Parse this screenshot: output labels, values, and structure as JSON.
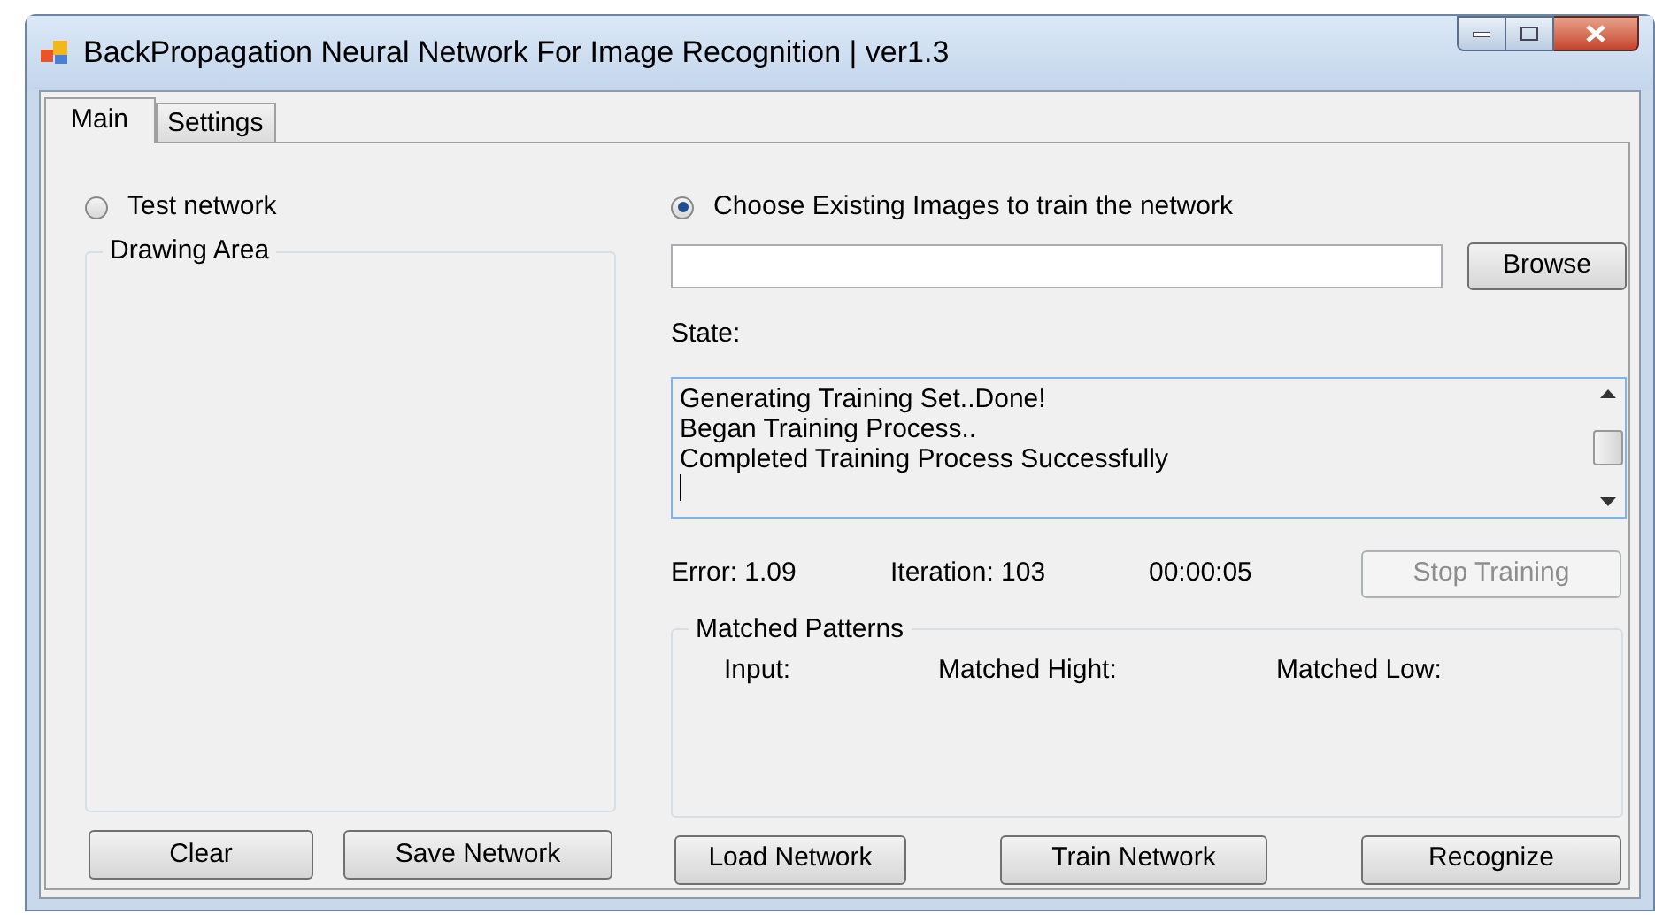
{
  "window": {
    "title": "BackPropagation Neural Network For Image Recognition | ver1.3"
  },
  "tabs": [
    {
      "label": "Main",
      "selected": true
    },
    {
      "label": "Settings",
      "selected": false
    }
  ],
  "left": {
    "mode": {
      "label": "Test network",
      "selected": false
    },
    "drawing_area": {
      "title": "Drawing Area"
    },
    "buttons": [
      "Clear",
      "Save Network"
    ]
  },
  "right": {
    "mode": {
      "label": "Choose Existing Images to train the network",
      "selected": true
    },
    "browse_button": "Browse",
    "state_label": "State:",
    "log": [
      "Generating Training Set..Done!",
      "Began Training Process..",
      "Completed Training Process Successfully"
    ],
    "error": "Error: 1.09",
    "iteration": "Iteration: 103",
    "elapsed": "00:00:05",
    "stop_button": {
      "label": "Stop Training",
      "disabled": true
    },
    "matched_patterns": {
      "title": "Matched Patterns",
      "columns": [
        "Input:",
        "Matched Hight:",
        "Matched Low:"
      ]
    },
    "buttons": [
      "Load Network",
      "Train Network",
      "Recognize"
    ]
  }
}
